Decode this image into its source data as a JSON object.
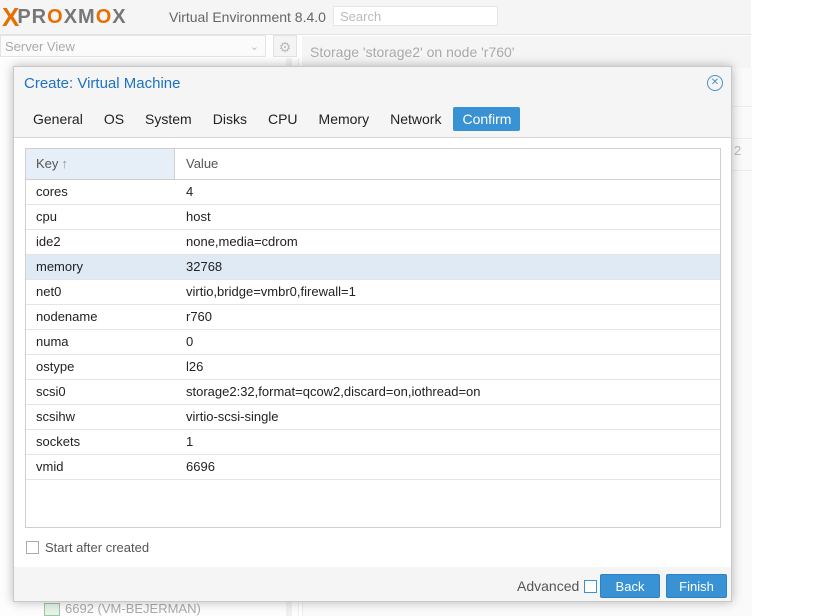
{
  "app": {
    "logo_text": "PROXMOX",
    "version": "Virtual Environment 8.4.0",
    "search_placeholder": "Search",
    "server_view": "Server View",
    "storage_header": "Storage 'storage2' on node 'r760'",
    "bottom_tree_item": "6692 (VM-BEJERMAN)",
    "right_edge_text": "2"
  },
  "modal": {
    "title": "Create: Virtual Machine",
    "tabs": [
      "General",
      "OS",
      "System",
      "Disks",
      "CPU",
      "Memory",
      "Network",
      "Confirm"
    ],
    "active_tab": "Confirm",
    "grid": {
      "headers": {
        "key": "Key",
        "value": "Value"
      },
      "sort_indicator": "↑",
      "rows": [
        {
          "key": "cores",
          "value": "4"
        },
        {
          "key": "cpu",
          "value": "host"
        },
        {
          "key": "ide2",
          "value": "none,media=cdrom"
        },
        {
          "key": "memory",
          "value": "32768"
        },
        {
          "key": "net0",
          "value": "virtio,bridge=vmbr0,firewall=1"
        },
        {
          "key": "nodename",
          "value": "r760"
        },
        {
          "key": "numa",
          "value": "0"
        },
        {
          "key": "ostype",
          "value": "l26"
        },
        {
          "key": "scsi0",
          "value": "storage2:32,format=qcow2,discard=on,iothread=on"
        },
        {
          "key": "scsihw",
          "value": "virtio-scsi-single"
        },
        {
          "key": "sockets",
          "value": "1"
        },
        {
          "key": "vmid",
          "value": "6696"
        }
      ],
      "selected_row": "memory"
    },
    "start_after_label": "Start after created",
    "advanced_label": "Advanced",
    "back_label": "Back",
    "finish_label": "Finish"
  },
  "colors": {
    "accent": "#3892d4",
    "title": "#1c72c2",
    "brand_orange": "#e57000",
    "selected_row": "#dfeaf5"
  }
}
